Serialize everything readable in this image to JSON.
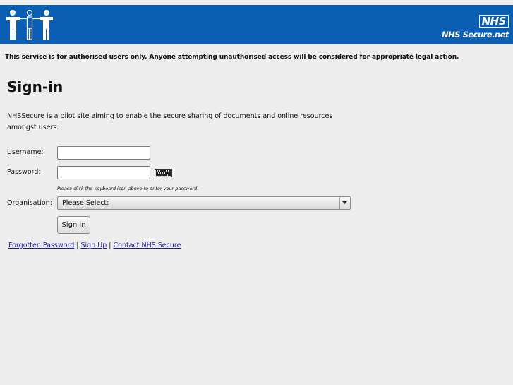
{
  "header": {
    "logo_icon": "people-figures-logo-icon",
    "badge": "NHS",
    "site_name": "NHS Secure.net",
    "background": "#0a5eb4"
  },
  "warning": "This service is for authorised users only. Anyone attempting unauthorised access will be considered for appropriate legal action.",
  "title": "Sign-in",
  "intro": "NHSSecure is a pilot site aiming to enable the secure sharing of documents and online resources amongst users.",
  "form": {
    "username_label": "Username:",
    "username_value": "",
    "password_label": "Password:",
    "password_value": "",
    "keyboard_icon": "virtual-keyboard-icon",
    "password_hint": "Please click the keyboard icon above to enter your password.",
    "organisation_label": "Organisation:",
    "organisation_selected": "Please Select:",
    "submit_label": "Sign in"
  },
  "links": {
    "forgot": "Forgotten Password",
    "separator": "|",
    "signup": "Sign Up",
    "contact": "Contact NHS Secure",
    "color": "#1a1aa6"
  }
}
